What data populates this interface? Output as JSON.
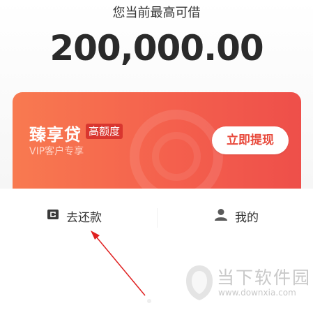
{
  "limit": {
    "label": "您当前最高可借",
    "amount": "200,000.00"
  },
  "product_card": {
    "name": "臻享贷",
    "tag": "高额度",
    "subtitle": "VIP客户专享",
    "action_label": "立即提现"
  },
  "tabs": [
    {
      "label": "去还款",
      "icon": "wallet-icon"
    },
    {
      "label": "我的",
      "icon": "user-icon"
    }
  ],
  "watermark": {
    "site_name": "当下软件园",
    "url": "www.downxia.com"
  },
  "colors": {
    "card_gradient_start": "#f87a50",
    "card_gradient_end": "#ee4f4a",
    "tag_bg": "#d9362f",
    "accent": "#e84a3c",
    "annotation_arrow": "#e02020"
  }
}
